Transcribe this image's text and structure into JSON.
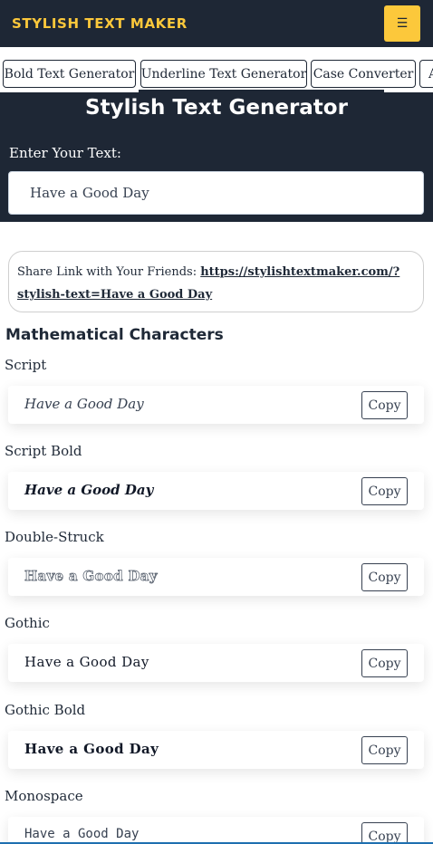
{
  "header": {
    "brand": "STYLISH TEXT MAKER",
    "menu_icon": "☰",
    "colors": {
      "bg": "#1e2735",
      "accent": "#fcc83b"
    }
  },
  "tabs": [
    {
      "label": "Bold Text Generator"
    },
    {
      "label": "Underline Text Generator",
      "active": true
    },
    {
      "label": "Case Converter"
    },
    {
      "label": "A"
    }
  ],
  "hero": {
    "title": "Stylish Text Generator",
    "input_label": "Enter Your Text:",
    "input_value": "Have a Good Day"
  },
  "share": {
    "prefix": "Share Link with Your Friends: ",
    "link": "https://stylishtextmaker.com/?stylish-text=Have a Good Day"
  },
  "section": {
    "title": "Mathematical Characters"
  },
  "styles": [
    {
      "label": "Script",
      "text": "Have a Good Day",
      "copy": "Copy"
    },
    {
      "label": "Script Bold",
      "text": "Have a Good Day",
      "copy": "Copy"
    },
    {
      "label": "Double-Struck",
      "text": "Have a Good Day",
      "copy": "Copy"
    },
    {
      "label": "Gothic",
      "text": "Have a Good Day",
      "copy": "Copy"
    },
    {
      "label": "Gothic Bold",
      "text": "Have a Good Day",
      "copy": "Copy"
    },
    {
      "label": "Monospace",
      "text": "Have a Good Day",
      "copy": "Copy"
    }
  ]
}
